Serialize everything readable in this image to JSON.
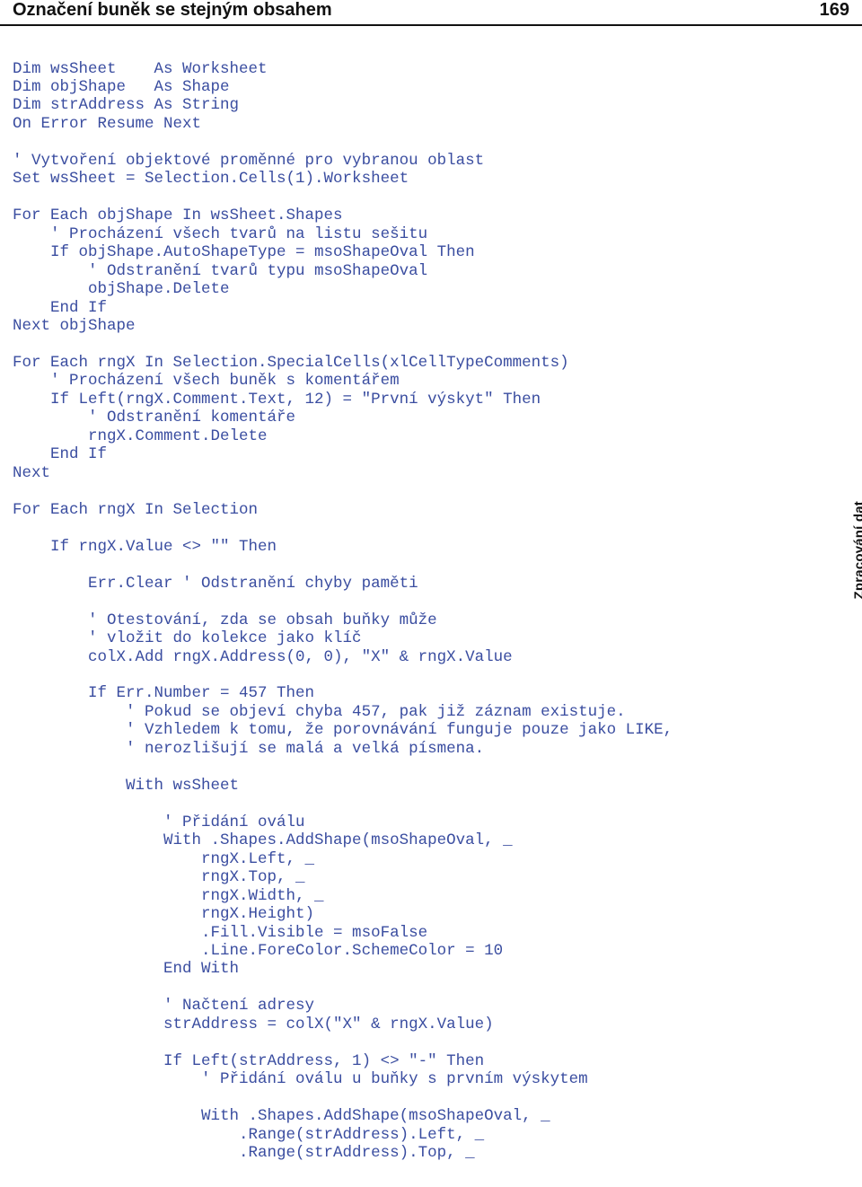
{
  "header": {
    "title": "Označení buněk se stejným obsahem",
    "page_number": "169"
  },
  "side_tab": "Zpracování dat",
  "code": "Dim wsSheet    As Worksheet\nDim objShape   As Shape\nDim strAddress As String\nOn Error Resume Next\n\n' Vytvoření objektové proměnné pro vybranou oblast\nSet wsSheet = Selection.Cells(1).Worksheet\n\nFor Each objShape In wsSheet.Shapes\n    ' Procházení všech tvarů na listu sešitu\n    If objShape.AutoShapeType = msoShapeOval Then\n        ' Odstranění tvarů typu msoShapeOval\n        objShape.Delete\n    End If\nNext objShape\n\nFor Each rngX In Selection.SpecialCells(xlCellTypeComments)\n    ' Procházení všech buněk s komentářem\n    If Left(rngX.Comment.Text, 12) = \"První výskyt\" Then\n        ' Odstranění komentáře\n        rngX.Comment.Delete\n    End If\nNext\n\nFor Each rngX In Selection\n\n    If rngX.Value <> \"\" Then\n\n        Err.Clear ' Odstranění chyby paměti\n\n        ' Otestování, zda se obsah buňky může\n        ' vložit do kolekce jako klíč\n        colX.Add rngX.Address(0, 0), \"X\" & rngX.Value\n\n        If Err.Number = 457 Then\n            ' Pokud se objeví chyba 457, pak již záznam existuje.\n            ' Vzhledem k tomu, že porovnávání funguje pouze jako LIKE,\n            ' nerozlišují se malá a velká písmena.\n\n            With wsSheet\n\n                ' Přidání oválu\n                With .Shapes.AddShape(msoShapeOval, _\n                    rngX.Left, _\n                    rngX.Top, _\n                    rngX.Width, _\n                    rngX.Height)\n                    .Fill.Visible = msoFalse\n                    .Line.ForeColor.SchemeColor = 10\n                End With\n\n                ' Načtení adresy\n                strAddress = colX(\"X\" & rngX.Value)\n\n                If Left(strAddress, 1) <> \"-\" Then\n                    ' Přidání oválu u buňky s prvním výskytem\n\n                    With .Shapes.AddShape(msoShapeOval, _\n                        .Range(strAddress).Left, _\n                        .Range(strAddress).Top, _"
}
